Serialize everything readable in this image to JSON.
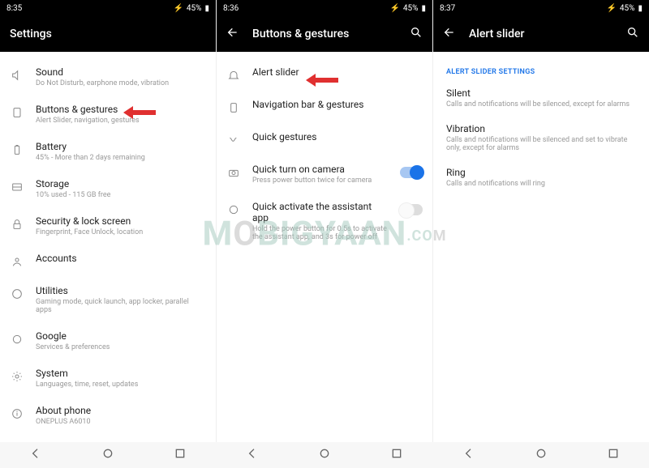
{
  "status": {
    "time1": "8:35",
    "time2": "8:36",
    "time3": "8:37",
    "battery": "45%"
  },
  "p1": {
    "title": "Settings",
    "items": [
      {
        "label": "Sound",
        "sub": "Do Not Disturb, earphone mode, vibration"
      },
      {
        "label": "Buttons & gestures",
        "sub": "Alert Slider, navigation, gestures"
      },
      {
        "label": "Battery",
        "sub": "45% - More than 2 days remaining"
      },
      {
        "label": "Storage",
        "sub": "10% used - 115 GB free"
      },
      {
        "label": "Security & lock screen",
        "sub": "Fingerprint, Face Unlock, location"
      },
      {
        "label": "Accounts",
        "sub": ""
      },
      {
        "label": "Utilities",
        "sub": "Gaming mode, quick launch, app locker, parallel apps"
      },
      {
        "label": "Google",
        "sub": "Services & preferences"
      },
      {
        "label": "System",
        "sub": "Languages, time, reset, updates"
      },
      {
        "label": "About phone",
        "sub": "ONEPLUS A6010"
      }
    ]
  },
  "p2": {
    "title": "Buttons & gestures",
    "items": [
      {
        "label": "Alert slider",
        "sub": ""
      },
      {
        "label": "Navigation bar & gestures",
        "sub": ""
      },
      {
        "label": "Quick gestures",
        "sub": ""
      },
      {
        "label": "Quick turn on camera",
        "sub": "Press power button twice for camera"
      },
      {
        "label": "Quick activate the assistant app",
        "sub": "Hold the power button for 0.5s to activate the assistant app, and 3s for power off"
      }
    ]
  },
  "p3": {
    "title": "Alert slider",
    "section": "ALERT SLIDER SETTINGS",
    "items": [
      {
        "label": "Silent",
        "sub": "Calls and notifications will be silenced, except for alarms"
      },
      {
        "label": "Vibration",
        "sub": "Calls and notifications will be silenced and set to vibrate only, except for alarms"
      },
      {
        "label": "Ring",
        "sub": "Calls and notifications will ring"
      }
    ]
  },
  "watermark": {
    "a": "M",
    "b": "BIGYAAN",
    "c": "O",
    "d": "M"
  }
}
